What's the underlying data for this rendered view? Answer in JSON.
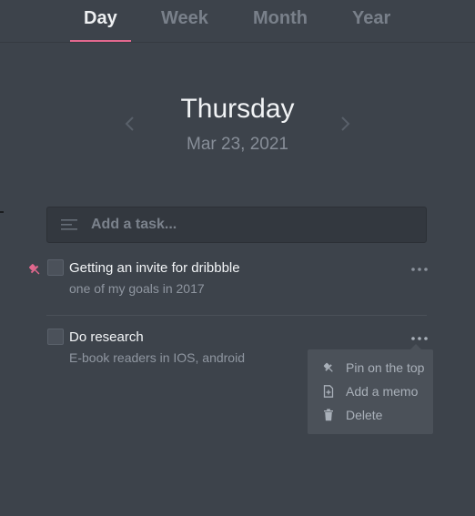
{
  "tabs": [
    {
      "label": "Day",
      "active": true
    },
    {
      "label": "Week",
      "active": false
    },
    {
      "label": "Month",
      "active": false
    },
    {
      "label": "Year",
      "active": false
    }
  ],
  "date": {
    "weekday": "Thursday",
    "date": "Mar 23, 2021"
  },
  "add_task": {
    "placeholder": "Add a task...",
    "value": ""
  },
  "tasks": [
    {
      "title": "Getting an invite for dribbble",
      "subtitle": "one of my goals in 2017",
      "pinned": true,
      "checked": false
    },
    {
      "title": "Do research",
      "subtitle": "E-book readers in IOS, android",
      "pinned": false,
      "checked": false
    }
  ],
  "task_menu": {
    "items": [
      {
        "label": "Pin on the top",
        "icon": "pin-icon"
      },
      {
        "label": "Add a memo",
        "icon": "memo-icon"
      },
      {
        "label": "Delete",
        "icon": "trash-icon"
      }
    ]
  },
  "colors": {
    "background": "#3d434b",
    "accent": "#e2688e",
    "input_background": "#33383f",
    "menu_background": "#4b5159"
  }
}
